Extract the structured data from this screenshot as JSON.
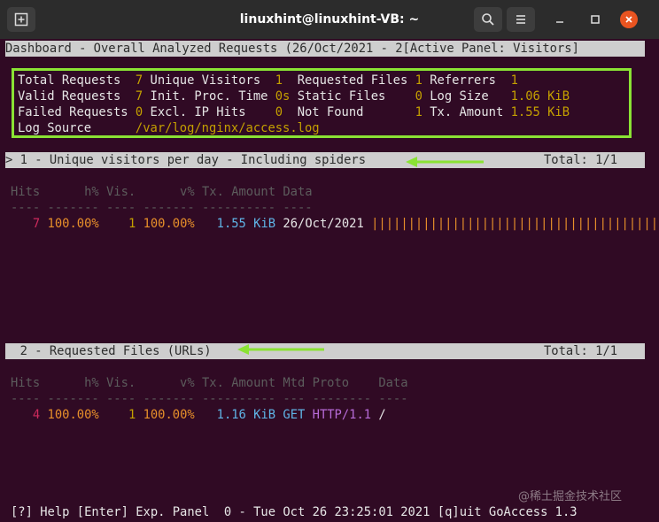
{
  "window": {
    "title": "linuxhint@linuxhint-VB: ~"
  },
  "header_bar": "Dashboard - Overall Analyzed Requests (26/Oct/2021 - 2[Active Panel: Visitors]",
  "stats": {
    "rows": [
      [
        {
          "label": "Total Requests  ",
          "value": "7"
        },
        {
          "label": "Unique Visitors  ",
          "value": "1"
        },
        {
          "label": "Requested Files ",
          "value": "1"
        },
        {
          "label": "Referrers  ",
          "value": "1"
        }
      ],
      [
        {
          "label": "Valid Requests  ",
          "value": "7"
        },
        {
          "label": "Init. Proc. Time ",
          "value": "0s"
        },
        {
          "label": "Static Files    ",
          "value": "0"
        },
        {
          "label": "Log Size   ",
          "value": "1.06 KiB"
        }
      ],
      [
        {
          "label": "Failed Requests ",
          "value": "0"
        },
        {
          "label": "Excl. IP Hits    ",
          "value": "0"
        },
        {
          "label": "Not Found       ",
          "value": "1"
        },
        {
          "label": "Tx. Amount ",
          "value": "1.55 KiB"
        }
      ]
    ],
    "log_source_label": "Log Source",
    "log_source_value": "/var/log/nginx/access.log"
  },
  "panel1": {
    "title": "> 1 - Unique visitors per day - Including spiders",
    "total": "Total: 1/1",
    "header": "Hits      h% Vis.      v% Tx. Amount Data",
    "separator": "---- ------- ---- ------- ---------- ----",
    "row": {
      "hits": "7",
      "hits_pct": "100.00%",
      "visitors": "1",
      "visitors_pct": "100.00%",
      "tx": "1.55 KiB",
      "date": "26/Oct/2021",
      "bar": "||||||||||||||||||||||||||||||||||||||||"
    }
  },
  "panel2": {
    "title": "  2 - Requested Files (URLs)",
    "total": "Total: 1/1",
    "header": "Hits      h% Vis.      v% Tx. Amount Mtd Proto    Data",
    "separator": "---- ------- ---- ------- ---------- --- -------- ----",
    "row": {
      "hits": "4",
      "hits_pct": "100.00%",
      "visitors": "1",
      "visitors_pct": "100.00%",
      "tx": "1.16 KiB",
      "method": "GET",
      "protocol": "HTTP/1.1",
      "data": "/"
    }
  },
  "footer": "[?] Help [Enter] Exp. Panel  0 - Tue Oct 26 23:25:01 2021 [q]uit GoAccess 1.3",
  "watermark": "@稀土掘金技术社区",
  "colors": {
    "arrow": "#8ae234",
    "close_button": "#e95420",
    "background": "#300a24"
  }
}
